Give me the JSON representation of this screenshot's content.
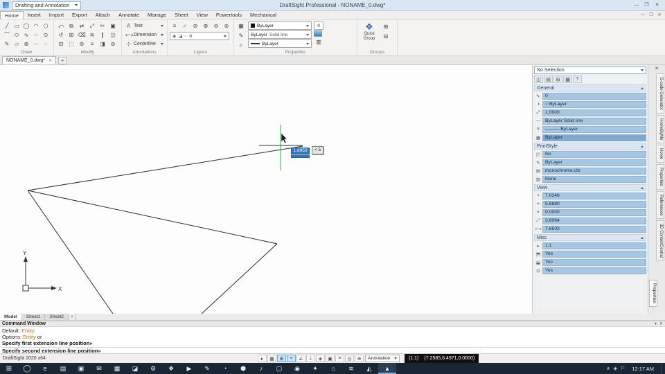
{
  "titlebar": {
    "workspace": "Drafting and Annotation",
    "title": "DraftSight Professional - NONAME_0.dwg*",
    "controls": [
      "—",
      "❐",
      "✕"
    ]
  },
  "menubar": {
    "items": [
      {
        "label": "Home",
        "active": true
      },
      {
        "label": "Insert"
      },
      {
        "label": "Import"
      },
      {
        "label": "Export"
      },
      {
        "label": "Attach"
      },
      {
        "label": "Annotate"
      },
      {
        "label": "Manage"
      },
      {
        "label": "Sheet"
      },
      {
        "label": "View"
      },
      {
        "label": "Powertools"
      },
      {
        "label": "Mechanical"
      }
    ],
    "doc_controls": [
      "—",
      "❐",
      "✕"
    ]
  },
  "ribbon": {
    "draw": {
      "label": "Draw",
      "icons": [
        "╱",
        "▭",
        "◯",
        "◠",
        "⬡",
        "⌒",
        "⬭",
        "∿",
        "┄",
        "⊙",
        "✎",
        "▱",
        "⊕",
        "⋯",
        "◌"
      ]
    },
    "modify": {
      "label": "Modify",
      "icons": [
        "⤺",
        "⧉",
        "⇄",
        "⤢",
        "✂",
        "▣",
        "↺",
        "⊞",
        "⌫",
        "≋",
        "∥",
        "◫",
        "⊟",
        "⬚",
        "⊜",
        "≡",
        "◨",
        "⊘"
      ]
    },
    "annotations": {
      "label": "Annotations",
      "buttons": [
        {
          "icon": "A",
          "label": "Text"
        },
        {
          "icon": "⟷",
          "label": "Dimension"
        },
        {
          "icon": "⊹",
          "label": "Centerline"
        }
      ]
    },
    "layers": {
      "label": "Layers",
      "icons": [
        {
          "g": "≡"
        },
        {
          "g": "✓",
          "cls": "green"
        },
        {
          "g": "⊘"
        },
        {
          "g": "⊕"
        },
        {
          "g": "⊖"
        },
        {
          "g": "⊜"
        }
      ],
      "status": "◉ ◪ ▫",
      "value": "0"
    },
    "properties": {
      "label": "Properties",
      "left_icons": [
        "▦",
        "✎",
        "⌕"
      ],
      "color": "ByLayer",
      "linestyle": "ByLayer",
      "linestyle2": "Solid line",
      "weight": "0",
      "lineweight": "ByLayer",
      "right_icon": "▥"
    },
    "groups": {
      "label": "Groups",
      "qicon": "❖",
      "quick": "Quick Group",
      "icons": [
        "⊞",
        "⊟"
      ]
    }
  },
  "doctabs": {
    "tab": "NONAME_0.dwg*",
    "close": "✕",
    "add": "+"
  },
  "canvas": {
    "dim_value": "1.6953",
    "angle_value": "< 5",
    "axis_x": "X",
    "axis_y": "Y"
  },
  "props": {
    "selection": "No Selection",
    "tools": [
      "◫",
      "▤",
      "⊞",
      "▦"
    ],
    "help": "?",
    "general": {
      "title": "General",
      "rows": [
        {
          "icon": "✎",
          "value": "0"
        },
        {
          "icon": "◑",
          "value": "○ ByLayer"
        },
        {
          "icon": "⤢",
          "value": "1.0000"
        },
        {
          "icon": "—",
          "value": "ByLayer    Solid line"
        },
        {
          "icon": "≡",
          "value": "——— ByLayer"
        },
        {
          "icon": "▦",
          "value": "ByLayer",
          "active": true
        }
      ]
    },
    "printstyle": {
      "title": "PrintStyle",
      "rows": [
        {
          "icon": "◫",
          "value": "No"
        },
        {
          "icon": "✎",
          "value": "ByLayer"
        },
        {
          "icon": "▤",
          "value": "monochrome.ctb"
        },
        {
          "icon": "▥",
          "value": "None"
        }
      ]
    },
    "view": {
      "title": "View",
      "rows": [
        {
          "icon": "⌖",
          "value": "7.0246"
        },
        {
          "icon": "⌖",
          "value": "5.8880"
        },
        {
          "icon": "⌖",
          "value": "0.0000"
        },
        {
          "icon": "⤢",
          "value": "3.6064"
        },
        {
          "icon": "⟷",
          "value": "7.6503"
        }
      ]
    },
    "misc": {
      "title": "Misc",
      "rows": [
        {
          "icon": "▸",
          "value": "1:1"
        },
        {
          "icon": "⬒",
          "value": "Yes"
        },
        {
          "icon": "⬓",
          "value": "Yes"
        },
        {
          "icon": "⊡",
          "value": "Yes"
        }
      ]
    }
  },
  "side": {
    "close": "✕",
    "tabs": [
      {
        "label": "G-code Generator"
      },
      {
        "label": "HomeByMe"
      },
      {
        "label": "Home"
      },
      {
        "label": "Properties"
      },
      {
        "label": "References"
      },
      {
        "label": "3D ContentCentral"
      }
    ],
    "palette": "Properties"
  },
  "sheets": {
    "tabs": [
      {
        "label": "Model",
        "active": true
      },
      {
        "label": "Sheet1"
      },
      {
        "label": "Sheet2"
      }
    ],
    "add": "+"
  },
  "cmd": {
    "title": "Command Window",
    "icons": [
      "▾",
      "✕"
    ],
    "l1_prefix": "Default: ",
    "l1_value": "Entity",
    "l2_prefix": "Options: ",
    "l2_value": "Entity",
    "l2_suffix": " or",
    "l3": "Specify first extension line position»",
    "prompt": "Specify second extension line position»"
  },
  "status": {
    "app": "DraftSight 2020 x64",
    "icons": [
      {
        "g": "▸"
      },
      {
        "g": "▦"
      },
      {
        "g": "⊞",
        "active": true
      },
      {
        "g": "⌖",
        "active": true
      },
      {
        "g": "∠"
      },
      {
        "g": "⟂"
      },
      {
        "g": "◈"
      },
      {
        "g": "▣"
      },
      {
        "g": "≡"
      },
      {
        "g": "◎"
      },
      {
        "g": "⊕"
      }
    ],
    "annotation": "Annotation",
    "scale": "(1:1)",
    "coords": "(7.2585,6.4971,0.0000)"
  },
  "taskbar": {
    "start": "⊞",
    "search": "◯",
    "apps": [
      {
        "g": "e"
      },
      {
        "g": "▤"
      },
      {
        "g": "▣"
      },
      {
        "g": "✉"
      },
      {
        "g": "▦"
      },
      {
        "g": "◪"
      },
      {
        "g": "⚙"
      },
      {
        "g": "❖"
      },
      {
        "g": "▶"
      },
      {
        "g": "✎"
      },
      {
        "g": "◔"
      },
      {
        "g": "⬢"
      },
      {
        "g": "♪"
      },
      {
        "g": "▢"
      },
      {
        "g": "◉"
      },
      {
        "g": "✦"
      },
      {
        "g": "⌂"
      },
      {
        "g": "≋"
      },
      {
        "g": "◭"
      },
      {
        "g": "▲",
        "active": true
      }
    ],
    "tray": [
      "∧",
      "◈",
      "⚐"
    ],
    "time": "12:17 AM"
  }
}
